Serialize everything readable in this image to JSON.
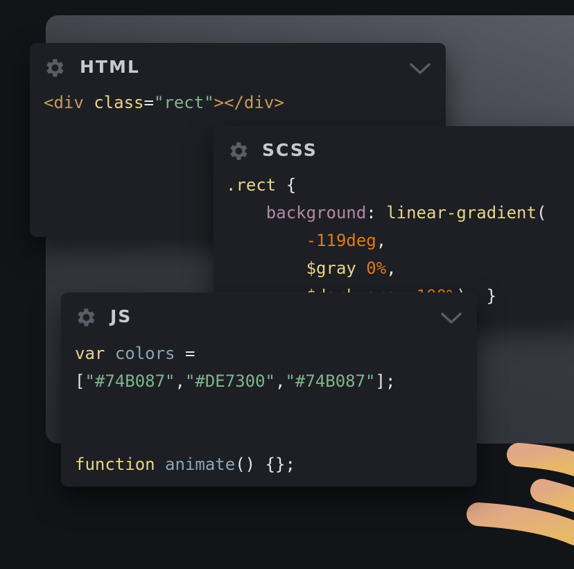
{
  "panels": {
    "html": {
      "title": "HTML",
      "code": {
        "open_tag": "<div",
        "attr": "class",
        "eq": "=",
        "value": "\"rect\"",
        "close": "></div>"
      }
    },
    "scss": {
      "title": "SCSS",
      "code": {
        "selector": ".rect",
        "brace_open": "{",
        "property": "background",
        "colon": ":",
        "func": "linear-gradient",
        "paren_open": "(",
        "angle": "-119deg",
        "comma1": ",",
        "var1": "$gray",
        "stop1": "0%",
        "comma2": ",",
        "var2": "$dark-gray",
        "stop2": "100%",
        "end": "); }"
      }
    },
    "js": {
      "title": "JS",
      "code": {
        "kw_var": "var",
        "ident": "colors",
        "eq": "=",
        "bracket_open": "[",
        "color1": "\"#74B087\"",
        "sep1": ",",
        "color2": "\"#DE7300\"",
        "sep2": ",",
        "color3": "\"#74B087\"",
        "bracket_close": "];",
        "kw_function": "function",
        "fn_name": "animate",
        "fn_rest": "() {};"
      }
    }
  },
  "icons": {
    "settings": "gear-icon",
    "collapse": "chevron-down-icon"
  },
  "colors": {
    "green": "#74B087",
    "orange": "#DE7300",
    "panel_bg": "#1e1f24",
    "page_bg": "#131418"
  }
}
